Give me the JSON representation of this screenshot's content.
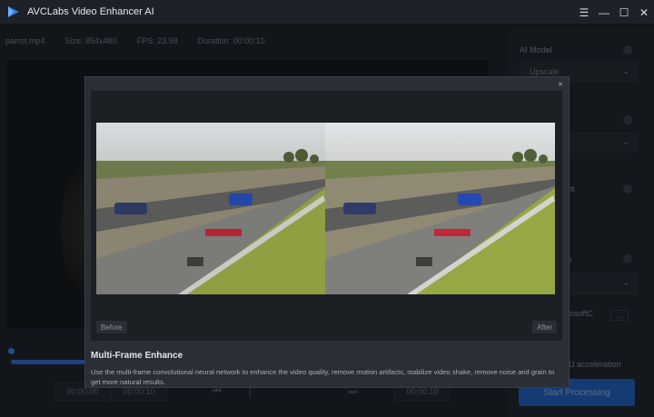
{
  "app": {
    "title": "AVCLabs Video Enhancer AI"
  },
  "window_controls": {
    "menu": "☰",
    "minimize": "—",
    "maximize": "☐",
    "close": "✕"
  },
  "info": {
    "file": "parrot.mp4",
    "size": "Size: 854x480",
    "fps": "FPS: 23.98",
    "duration": "Duration: 00:00:10"
  },
  "transport": {
    "start_time": "00:00:00",
    "mid_time": "00:00:10",
    "end_time": "00:00:10",
    "progress": 0.17
  },
  "sidebar": {
    "ai_model_label": "AI Model",
    "ai_model_value": "Upscale",
    "face_label": "ent",
    "encode_label": "gs",
    "encoder_value": "rosoftC",
    "gpu_label": "U acceleration",
    "more": "...",
    "start_button": "Start Processing"
  },
  "modal": {
    "close": "×",
    "before_label": "Before",
    "after_label": "After",
    "title": "Multi-Frame Enhance",
    "description": "Use the multi-frame convolutional neural network to enhance the video quality, remove motion artifacts, stabilize video shake, remove noise and grain to get more natural results."
  },
  "colors": {
    "accent": "#1f63c7",
    "background": "#1b1e24",
    "modal": "#2a2e35"
  },
  "icons": {
    "logo": "avclabs-logo-icon",
    "prev": "skip-back-icon",
    "next": "skip-forward-icon"
  }
}
